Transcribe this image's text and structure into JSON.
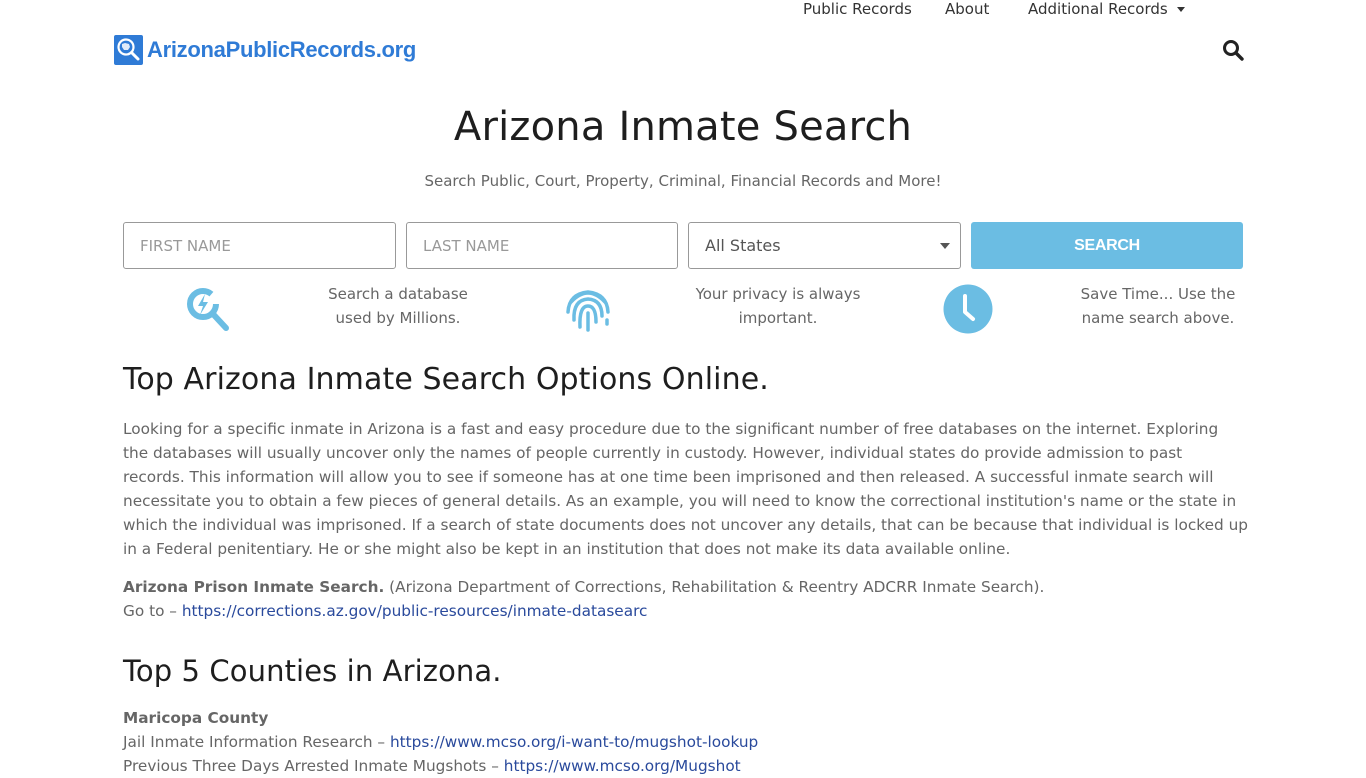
{
  "header": {
    "logo_text": "ArizonaPublicRecords.org",
    "brand_color": "#2f7bd6",
    "nav": [
      {
        "label": "Public Records"
      },
      {
        "label": "About"
      },
      {
        "label": "Additional Records",
        "has_dropdown": true
      }
    ],
    "search_icon": "search-icon"
  },
  "hero": {
    "title": "Arizona Inmate Search",
    "subtitle": "Search Public, Court, Property, Criminal, Financial Records and More!"
  },
  "search_form": {
    "first_name_placeholder": "FIRST NAME",
    "last_name_placeholder": "LAST NAME",
    "state_selected": "All States",
    "button_label": "SEARCH",
    "button_color": "#6bbde3"
  },
  "features": [
    {
      "icon": "lightning-search-icon",
      "text_line1": "Search a database",
      "text_line2": "used by Millions."
    },
    {
      "icon": "fingerprint-icon",
      "text_line1": "Your privacy is always",
      "text_line2": "important."
    },
    {
      "icon": "clock-icon",
      "text_line1": "Save Time... Use the",
      "text_line2": "name search above."
    }
  ],
  "section1": {
    "heading": "Top Arizona Inmate Search Options Online.",
    "paragraph": "Looking for a specific inmate in Arizona is a fast and easy procedure due to the significant number of free databases on the internet. Exploring the databases will usually uncover only the names of people currently in custody. However, individual states do provide admission to past records. This information will allow you to see if someone has at one time been imprisoned and then released. A successful inmate search will necessitate you to obtain a few pieces of general details. As an example, you will need to know the correctional institution's name or the state in which the individual was imprisoned. If a search of state documents does not uncover any details, that can be because that individual is locked up in a Federal penitentiary. He or she might also be kept in an institution that does not make its data available online.",
    "prison_label": "Arizona Prison Inmate Search.",
    "prison_desc": " (Arizona Department of Corrections, Rehabilitation & Reentry ADCRR Inmate Search).",
    "goto_prefix": "Go to – ",
    "prison_link": "https://corrections.az.gov/public-resources/inmate-datasearc"
  },
  "section2": {
    "heading": "Top 5 Counties in Arizona.",
    "county_name": "Maricopa County",
    "line1_prefix": "Jail Inmate Information Research – ",
    "line1_link": "https://www.mcso.org/i-want-to/mugshot-lookup",
    "line2_prefix": "Previous Three Days Arrested Inmate Mugshots – ",
    "line2_link": "https://www.mcso.org/Mugshot"
  },
  "colors": {
    "link": "#2a4a9c",
    "icon_accent": "#6bbde3"
  }
}
